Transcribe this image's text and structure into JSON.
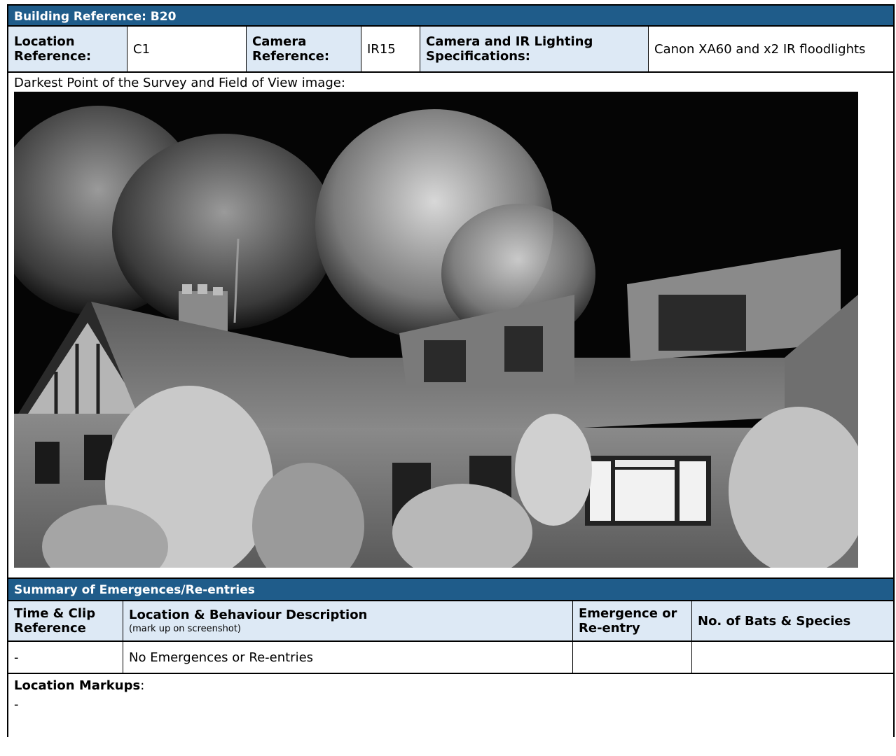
{
  "building": {
    "heading": "Building Reference: B20"
  },
  "info_row": {
    "location_label": "Location Reference:",
    "location_value": "C1",
    "camera_label": "Camera Reference:",
    "camera_value": "IR15",
    "spec_label": "Camera and IR Lighting Specifications:",
    "spec_value": "Canon XA60 and x2 IR floodlights"
  },
  "survey_image": {
    "caption": "Darkest Point of the Survey and Field of View image:"
  },
  "summary": {
    "heading": "Summary of Emergences/Re-entries",
    "columns": {
      "time": "Time & Clip Reference",
      "location": "Location & Behaviour Description",
      "location_note": "(mark up on screenshot)",
      "emergence": "Emergence or Re-entry",
      "bats": "No. of Bats & Species"
    },
    "rows": [
      {
        "time": "-",
        "location": "No Emergences or Re-entries",
        "emergence": "",
        "bats": ""
      }
    ]
  },
  "markups": {
    "label": "Location Markups",
    "colon": ":",
    "value": "-"
  },
  "colors": {
    "header_bar": "#1f5c8a",
    "label_bg": "#dde9f5"
  }
}
